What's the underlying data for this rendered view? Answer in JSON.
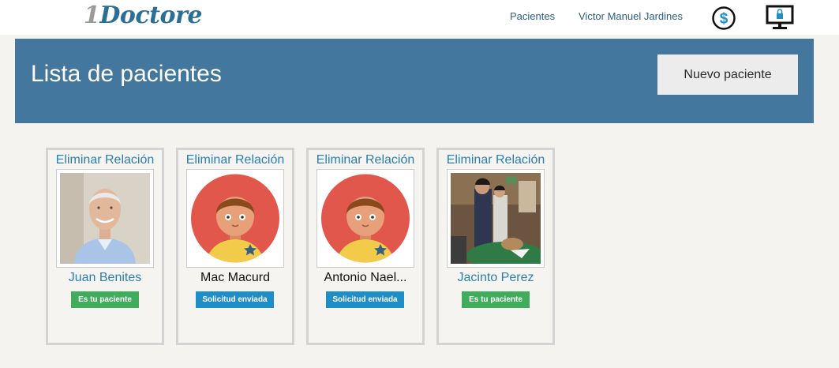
{
  "app": {
    "logo_first": "1",
    "logo_rest": "Doctore"
  },
  "nav": {
    "patients_label": "Pacientes",
    "user_label": "Victor Manuel Jardines",
    "billing_icon": "dollar-circle-icon",
    "security_icon": "locked-monitor-icon"
  },
  "header": {
    "title": "Lista de pacientes",
    "new_button_label": "Nuevo paciente"
  },
  "patients": [
    {
      "remove_label": "Eliminar Relación",
      "name": "Juan Benites",
      "status": "Es tu paciente",
      "photo": "photo-elderly-man"
    },
    {
      "remove_label": "Eliminar Relación",
      "name": "Mac Macurd",
      "status": "Solicitud enviada",
      "photo": "default-avatar"
    },
    {
      "remove_label": "Eliminar Relación",
      "name": "Antonio Nael...",
      "status": "Solicitud enviada",
      "photo": "default-avatar"
    },
    {
      "remove_label": "Eliminar Relación",
      "name": "Jacinto Perez",
      "status": "Es tu paciente",
      "photo": "photo-party-group"
    }
  ],
  "colors": {
    "brand_blue": "#44779e",
    "link_blue": "#2a7fb0",
    "status_green": "#3fad5c",
    "status_blue": "#1d8ec8",
    "avatar_red": "#e2574c",
    "avatar_yellow": "#f2cb4a"
  }
}
